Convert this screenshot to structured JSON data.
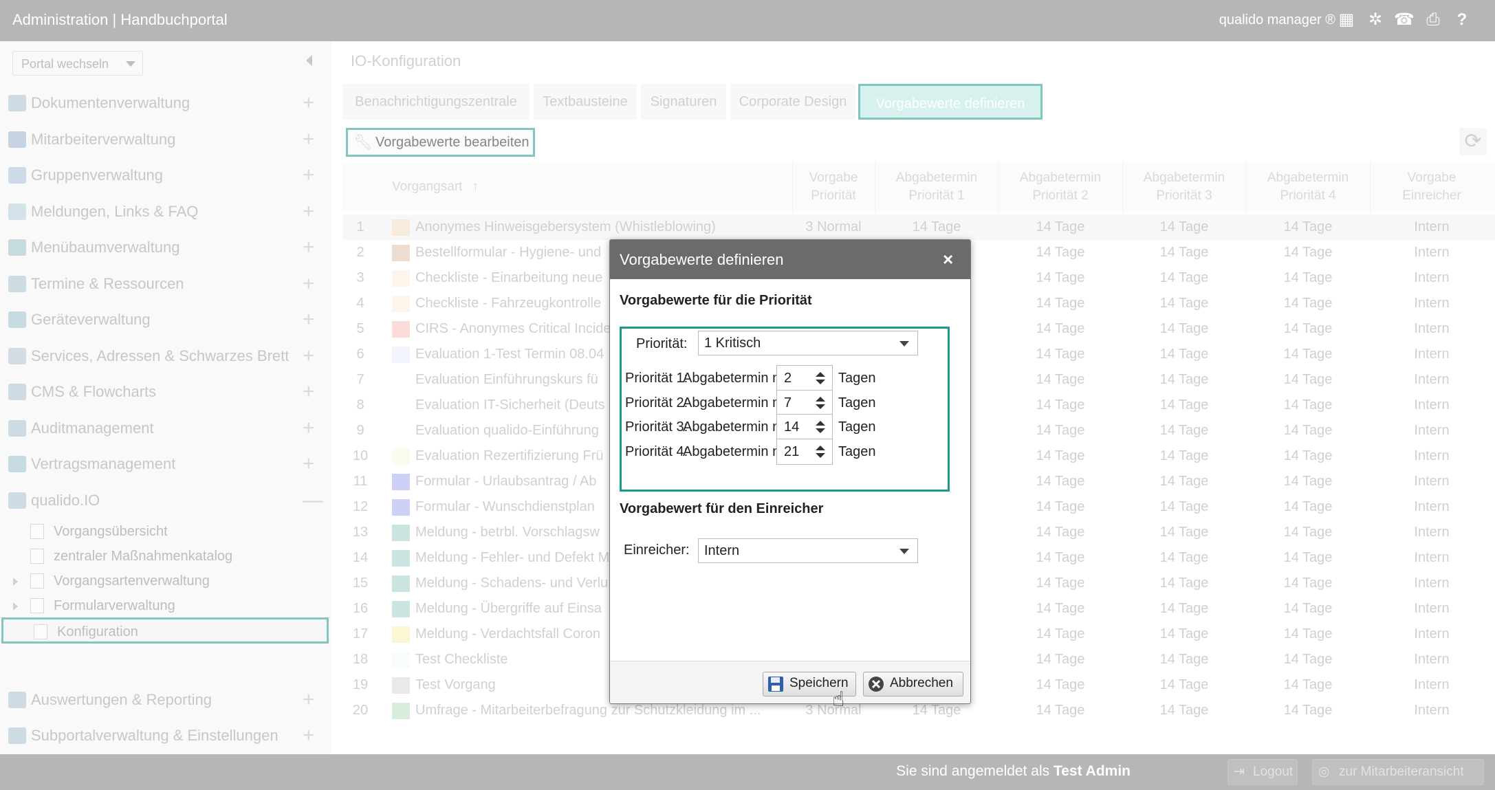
{
  "header": {
    "title": "Administration | Handbuchportal",
    "brand": "qualido manager ®",
    "icons": [
      "keyboard-icon",
      "network-icon",
      "fax-icon",
      "print-icon",
      "help-icon"
    ]
  },
  "sidebar": {
    "portal_select": "Portal wechseln",
    "items": [
      {
        "label": "Dokumentenverwaltung",
        "icon": "documents-icon"
      },
      {
        "label": "Mitarbeiterverwaltung",
        "icon": "users-icon"
      },
      {
        "label": "Gruppenverwaltung",
        "icon": "group-icon"
      },
      {
        "label": "Meldungen, Links & FAQ",
        "icon": "chat-icon"
      },
      {
        "label": "Menübaumverwaltung",
        "icon": "list-icon"
      },
      {
        "label": "Termine & Ressourcen",
        "icon": "calendar-icon"
      },
      {
        "label": "Geräteverwaltung",
        "icon": "device-icon"
      },
      {
        "label": "Services, Adressen & Schwarzes Brett",
        "icon": "addressbook-icon"
      },
      {
        "label": "CMS & Flowcharts",
        "icon": "cms-icon"
      },
      {
        "label": "Auditmanagement",
        "icon": "audit-icon"
      },
      {
        "label": "Vertragsmanagement",
        "icon": "paragraph-icon"
      },
      {
        "label": "qualido.IO",
        "icon": "qualido-io-icon"
      }
    ],
    "sub_items": [
      {
        "label": "Vorgangsübersicht"
      },
      {
        "label": "zentraler Maßnahmenkatalog"
      },
      {
        "label": "Vorgangsartenverwaltung"
      },
      {
        "label": "Formularverwaltung"
      },
      {
        "label": "Konfiguration"
      }
    ],
    "bottom_items": [
      {
        "label": "Auswertungen & Reporting",
        "icon": "chart-icon"
      },
      {
        "label": "Subportalverwaltung & Einstellungen",
        "icon": "home-icon"
      }
    ],
    "plus": "+",
    "minus": "—"
  },
  "main": {
    "title": "IO-Konfiguration",
    "tabs": [
      "Benachrichtigungszentrale",
      "Textbausteine",
      "Signaturen",
      "Corporate Design",
      "Vorgabewerte definieren"
    ],
    "edit_button": "Vorgabewerte bearbeiten",
    "table": {
      "headers": [
        "Vorgangsart",
        "Vorgabe Priorität",
        "Abgabetermin Priorität 1",
        "Abgabetermin Priorität 2",
        "Abgabetermin Priorität 3",
        "Abgabetermin Priorität 4",
        "Vorgabe Einreicher"
      ],
      "header_lines": [
        [
          "Vorgabe",
          "Priorität"
        ],
        [
          "Abgabetermin",
          "Priorität 1"
        ],
        [
          "Abgabetermin",
          "Priorität 2"
        ],
        [
          "Abgabetermin",
          "Priorität 3"
        ],
        [
          "Abgabetermin",
          "Priorität 4"
        ],
        [
          "Vorgabe",
          "Einreicher"
        ]
      ],
      "sort_arrow": "↑",
      "rows": [
        {
          "num": "1",
          "name": "Anonymes Hinweisgebersystem (Whistleblowing)",
          "color": "#f5c99a",
          "prio": "3 Normal",
          "p1": "14 Tage",
          "p2": "14 Tage",
          "p3": "14 Tage",
          "p4": "14 Tage",
          "einreicher": "Intern"
        },
        {
          "num": "2",
          "name": "Bestellformular - Hygiene- und",
          "color": "#c98a6a",
          "prio": "",
          "p1": "",
          "p2": "14 Tage",
          "p3": "14 Tage",
          "p4": "14 Tage",
          "einreicher": "Intern"
        },
        {
          "num": "3",
          "name": "Checkliste - Einarbeitung neue",
          "color": "#f9dcc0",
          "prio": "",
          "p1": "",
          "p2": "14 Tage",
          "p3": "14 Tage",
          "p4": "14 Tage",
          "einreicher": "Intern"
        },
        {
          "num": "4",
          "name": "Checkliste - Fahrzeugkontrolle",
          "color": "#f9dcc0",
          "prio": "",
          "p1": "",
          "p2": "14 Tage",
          "p3": "14 Tage",
          "p4": "14 Tage",
          "einreicher": "Intern"
        },
        {
          "num": "5",
          "name": "CIRS - Anonymes Critical Incide",
          "color": "#f08a80",
          "prio": "",
          "p1": "",
          "p2": "14 Tage",
          "p3": "14 Tage",
          "p4": "14 Tage",
          "einreicher": "Intern"
        },
        {
          "num": "6",
          "name": "Evaluation 1-Test Termin 08.04",
          "color": "#cfd8f8",
          "prio": "",
          "p1": "",
          "p2": "14 Tage",
          "p3": "14 Tage",
          "p4": "14 Tage",
          "einreicher": "Intern"
        },
        {
          "num": "7",
          "name": "Evaluation Einführungskurs fü",
          "color": "",
          "prio": "",
          "p1": "",
          "p2": "14 Tage",
          "p3": "14 Tage",
          "p4": "14 Tage",
          "einreicher": "Intern"
        },
        {
          "num": "8",
          "name": "Evaluation IT-Sicherheit (Deuts",
          "color": "",
          "prio": "",
          "p1": "",
          "p2": "14 Tage",
          "p3": "14 Tage",
          "p4": "14 Tage",
          "einreicher": "Intern"
        },
        {
          "num": "9",
          "name": "Evaluation qualido-Einführung",
          "color": "",
          "prio": "",
          "p1": "",
          "p2": "14 Tage",
          "p3": "14 Tage",
          "p4": "14 Tage",
          "einreicher": "Intern"
        },
        {
          "num": "10",
          "name": "Evaluation Rezertifizierung Frü",
          "color": "#f5f5c8",
          "prio": "",
          "p1": "",
          "p2": "14 Tage",
          "p3": "14 Tage",
          "p4": "14 Tage",
          "einreicher": "Intern"
        },
        {
          "num": "11",
          "name": "Formular - Urlaubsantrag / Ab",
          "color": "#5a66e0",
          "prio": "",
          "p1": "",
          "p2": "14 Tage",
          "p3": "14 Tage",
          "p4": "14 Tage",
          "einreicher": "Intern"
        },
        {
          "num": "12",
          "name": "Formular - Wunschdienstplan",
          "color": "#5a66e0",
          "prio": "",
          "p1": "",
          "p2": "14 Tage",
          "p3": "14 Tage",
          "p4": "14 Tage",
          "einreicher": "Intern"
        },
        {
          "num": "13",
          "name": "Meldung - betrbl. Vorschlagsw",
          "color": "#4fa69a",
          "prio": "",
          "p1": "",
          "p2": "14 Tage",
          "p3": "14 Tage",
          "p4": "14 Tage",
          "einreicher": "Intern"
        },
        {
          "num": "14",
          "name": "Meldung - Fehler- und Defekt M",
          "color": "#4fa69a",
          "prio": "",
          "p1": "",
          "p2": "14 Tage",
          "p3": "14 Tage",
          "p4": "14 Tage",
          "einreicher": "Intern"
        },
        {
          "num": "15",
          "name": "Meldung - Schadens- und Verlu",
          "color": "#4fa69a",
          "prio": "",
          "p1": "",
          "p2": "14 Tage",
          "p3": "14 Tage",
          "p4": "14 Tage",
          "einreicher": "Intern"
        },
        {
          "num": "16",
          "name": "Meldung - Übergriffe auf Einsa",
          "color": "#4fa69a",
          "prio": "",
          "p1": "",
          "p2": "14 Tage",
          "p3": "14 Tage",
          "p4": "14 Tage",
          "einreicher": "Intern"
        },
        {
          "num": "17",
          "name": "Meldung - Verdachtsfall Coron",
          "color": "#f0e070",
          "prio": "",
          "p1": "",
          "p2": "14 Tage",
          "p3": "14 Tage",
          "p4": "14 Tage",
          "einreicher": "Intern"
        },
        {
          "num": "18",
          "name": "Test Checkliste",
          "color": "#e4f8f0",
          "prio": "",
          "p1": "",
          "p2": "14 Tage",
          "p3": "14 Tage",
          "p4": "14 Tage",
          "einreicher": "Intern"
        },
        {
          "num": "19",
          "name": "Test Vorgang",
          "color": "#b8b8b8",
          "prio": "",
          "p1": "",
          "p2": "14 Tage",
          "p3": "14 Tage",
          "p4": "14 Tage",
          "einreicher": "Intern"
        },
        {
          "num": "20",
          "name": "Umfrage - Mitarbeiterbefragung zur Schutzkleidung im ...",
          "color": "#7fbf90",
          "prio": "3 Normal",
          "p1": "14 Tage",
          "p2": "14 Tage",
          "p3": "14 Tage",
          "p4": "14 Tage",
          "einreicher": "Intern"
        }
      ]
    }
  },
  "modal": {
    "title": "Vorgabewerte definieren",
    "close": "×",
    "section_priority": "Vorgabewerte für die Priorität",
    "priority_label": "Priorität:",
    "priority_value": "1 Kritisch",
    "deadline_label": "Abgabetermin nach",
    "days_label": "Tagen",
    "priorities": [
      {
        "label": "Priorität 1:",
        "value": "2"
      },
      {
        "label": "Priorität 2:",
        "value": "7"
      },
      {
        "label": "Priorität 3:",
        "value": "14"
      },
      {
        "label": "Priorität 4:",
        "value": "21"
      }
    ],
    "section_submitter": "Vorgabewert für den Einreicher",
    "submitter_label": "Einreicher:",
    "submitter_value": "Intern",
    "save": "Speichern",
    "cancel": "Abbrechen"
  },
  "footer": {
    "logged_in_prefix": "Sie sind angemeldet als",
    "user": "Test Admin",
    "logout": "Logout",
    "employee_view": "zur Mitarbeiteransicht"
  },
  "colors": {
    "accent": "#1a9a8a",
    "header": "#7a7a7a",
    "modal_header": "#6b6b6b"
  }
}
